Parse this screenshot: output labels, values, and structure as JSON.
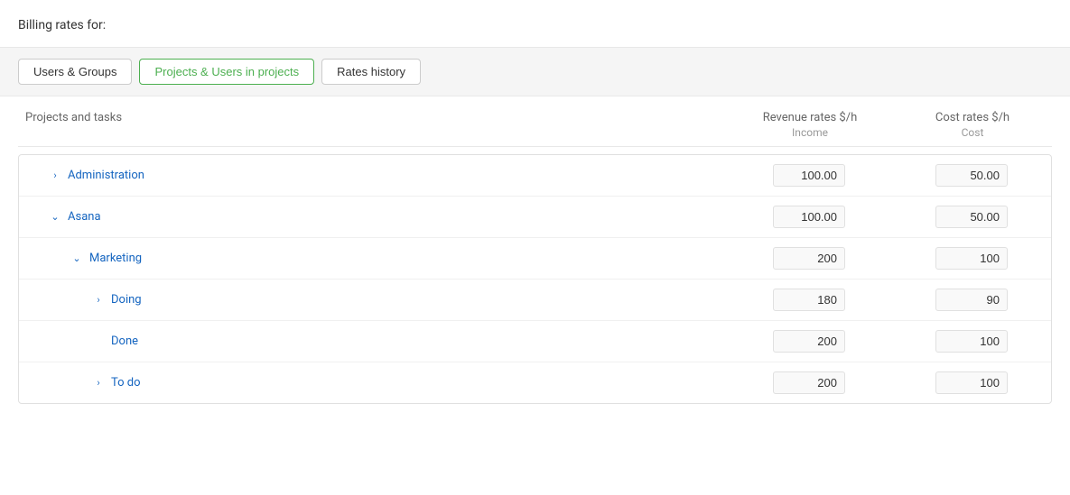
{
  "page": {
    "billing_title": "Billing rates for:",
    "tabs": [
      {
        "id": "users-groups",
        "label": "Users & Groups",
        "active": false
      },
      {
        "id": "projects-users",
        "label": "Projects & Users in projects",
        "active": true
      },
      {
        "id": "rates-history",
        "label": "Rates history",
        "active": false
      }
    ],
    "table": {
      "col_projects": "Projects and tasks",
      "col_revenue": "Revenue rates $/h",
      "col_revenue_sub": "Income",
      "col_cost": "Cost rates $/h",
      "col_cost_sub": "Cost",
      "rows": [
        {
          "id": "administration",
          "label": "Administration",
          "indent": 1,
          "chevron": "right",
          "revenue": "100.00",
          "cost": "50.00"
        },
        {
          "id": "asana",
          "label": "Asana",
          "indent": 1,
          "chevron": "down",
          "revenue": "100.00",
          "cost": "50.00"
        },
        {
          "id": "marketing",
          "label": "Marketing",
          "indent": 2,
          "chevron": "down",
          "revenue": "200",
          "cost": "100"
        },
        {
          "id": "doing",
          "label": "Doing",
          "indent": 3,
          "chevron": "right",
          "revenue": "180",
          "cost": "90"
        },
        {
          "id": "done",
          "label": "Done",
          "indent": 3,
          "chevron": "none",
          "revenue": "200",
          "cost": "100"
        },
        {
          "id": "todo",
          "label": "To do",
          "indent": 3,
          "chevron": "right",
          "revenue": "200",
          "cost": "100"
        }
      ]
    }
  },
  "icons": {
    "chevron_right": "›",
    "chevron_down": "∨"
  }
}
